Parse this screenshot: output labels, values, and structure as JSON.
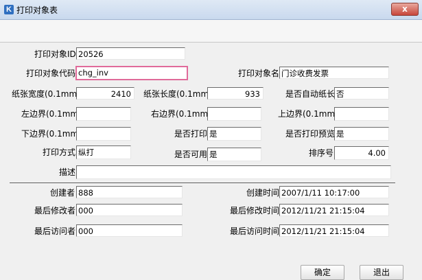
{
  "window": {
    "title": "打印对象表",
    "app_icon": "K",
    "close_glyph": "x"
  },
  "form": {
    "print_object_id": {
      "label": "打印对象ID",
      "value": "20526"
    },
    "print_object_code": {
      "label": "打印对象代码",
      "value": "chg_inv"
    },
    "print_object_name": {
      "label": "打印对象名",
      "value": "门诊收费发票"
    },
    "paper_width": {
      "label": "纸张宽度(0.1mm)",
      "value": "2410"
    },
    "paper_length": {
      "label": "纸张长度(0.1mm)",
      "value": "933"
    },
    "auto_paper_length": {
      "label": "是否自动纸长",
      "value": "否"
    },
    "left_margin": {
      "label": "左边界(0.1mm)",
      "value": ""
    },
    "right_margin": {
      "label": "右边界(0.1mm)",
      "value": ""
    },
    "top_margin": {
      "label": "上边界(0.1mm)",
      "value": ""
    },
    "bottom_margin": {
      "label": "下边界(0.1mm)",
      "value": ""
    },
    "is_print": {
      "label": "是否打印",
      "value": "是"
    },
    "is_print_preview": {
      "label": "是否打印预览",
      "value": "是"
    },
    "print_mode": {
      "label": "打印方式",
      "value": "纵打"
    },
    "is_available": {
      "label": "是否可用",
      "value": "是"
    },
    "sort_no": {
      "label": "排序号",
      "value": "4.00"
    },
    "description": {
      "label": "描述",
      "value": ""
    },
    "creator": {
      "label": "创建者",
      "value": "888"
    },
    "created_time": {
      "label": "创建时间",
      "value": "2007/1/11 10:17:00"
    },
    "last_modifier": {
      "label": "最后修改者",
      "value": "000"
    },
    "last_modified_time": {
      "label": "最后修改时间",
      "value": "2012/11/21 21:15:04"
    },
    "last_visitor": {
      "label": "最后访问者",
      "value": "000"
    },
    "last_visited_time": {
      "label": "最后访问时间",
      "value": "2012/11/21 21:15:04"
    }
  },
  "buttons": {
    "ok": "确定",
    "exit": "退出"
  },
  "colors": {
    "focus_border": "#e06a9a",
    "close_button": "#c7463a",
    "app_icon": "#2f6fc0"
  }
}
